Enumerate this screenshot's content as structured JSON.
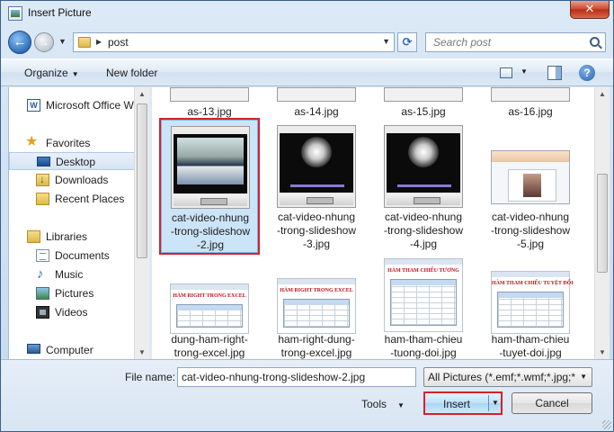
{
  "window": {
    "title": "Insert Picture",
    "close_glyph": "✕"
  },
  "nav": {
    "back_glyph": "←",
    "forward_glyph": "→",
    "history_glyph": "▼",
    "separator": "▸",
    "address": "post",
    "address_dropdown": "▼",
    "refresh_glyph": "⟳",
    "search_placeholder": "Search post"
  },
  "commandbar": {
    "organize": "Organize",
    "organize_arrow": "▼",
    "new_folder": "New folder",
    "view_arrow": "▼",
    "help": "?"
  },
  "navpane": {
    "items": [
      {
        "label": "Microsoft Office W",
        "icon": "word-icon"
      },
      {
        "label": "Favorites",
        "icon": "star-icon"
      },
      {
        "label": "Desktop",
        "icon": "desktop-icon"
      },
      {
        "label": "Downloads",
        "icon": "downloads-icon"
      },
      {
        "label": "Recent Places",
        "icon": "recent-places-icon"
      },
      {
        "label": "Libraries",
        "icon": "library-icon"
      },
      {
        "label": "Documents",
        "icon": "documents-icon"
      },
      {
        "label": "Music",
        "icon": "music-icon"
      },
      {
        "label": "Pictures",
        "icon": "pictures-icon"
      },
      {
        "label": "Videos",
        "icon": "videos-icon"
      },
      {
        "label": "Computer",
        "icon": "computer-icon"
      }
    ],
    "word_glyph": "W",
    "star_glyph": "★",
    "music_glyph": "♪"
  },
  "files": {
    "row1": [
      "as-13.jpg",
      "as-14.jpg",
      "as-15.jpg",
      "as-16.jpg"
    ],
    "row2": [
      {
        "line1": "cat-video-nhung",
        "line2": "-trong-slideshow",
        "line3": "-2.jpg"
      },
      {
        "line1": "cat-video-nhung",
        "line2": "-trong-slideshow",
        "line3": "-3.jpg"
      },
      {
        "line1": "cat-video-nhung",
        "line2": "-trong-slideshow",
        "line3": "-4.jpg"
      },
      {
        "line1": "cat-video-nhung",
        "line2": "-trong-slideshow",
        "line3": "-5.jpg"
      }
    ],
    "row3": [
      {
        "line1": "dung-ham-right-",
        "line2": "trong-excel.jpg",
        "title": "HÀM RIGHT TRONG EXCEL"
      },
      {
        "line1": "ham-right-dung-",
        "line2": "trong-excel.jpg",
        "title": "HÀM RIGHT TRONG EXCEL"
      },
      {
        "line1": "ham-tham-chieu",
        "line2": "-tuong-doi.jpg",
        "title": "HÀM THAM CHIẾU TƯƠNG"
      },
      {
        "line1": "ham-tham-chieu",
        "line2": "-tuyet-doi.jpg",
        "title": "HÀM THAM CHIẾU TUYỆT ĐỐI"
      }
    ]
  },
  "bottom": {
    "file_name_label": "File name:",
    "file_name_value": "cat-video-nhung-trong-slideshow-2.jpg",
    "filter": "All Pictures (*.emf;*.wmf;*.jpg;*",
    "filter_arrow": "▼",
    "tools": "Tools",
    "tools_arrow": "▼",
    "insert": "Insert",
    "insert_arrow": "▼",
    "cancel": "Cancel"
  },
  "scroll": {
    "up": "▲",
    "down": "▼"
  },
  "colors": {
    "highlight_red": "#d8202a",
    "selection_blue": "#cce4f7"
  }
}
